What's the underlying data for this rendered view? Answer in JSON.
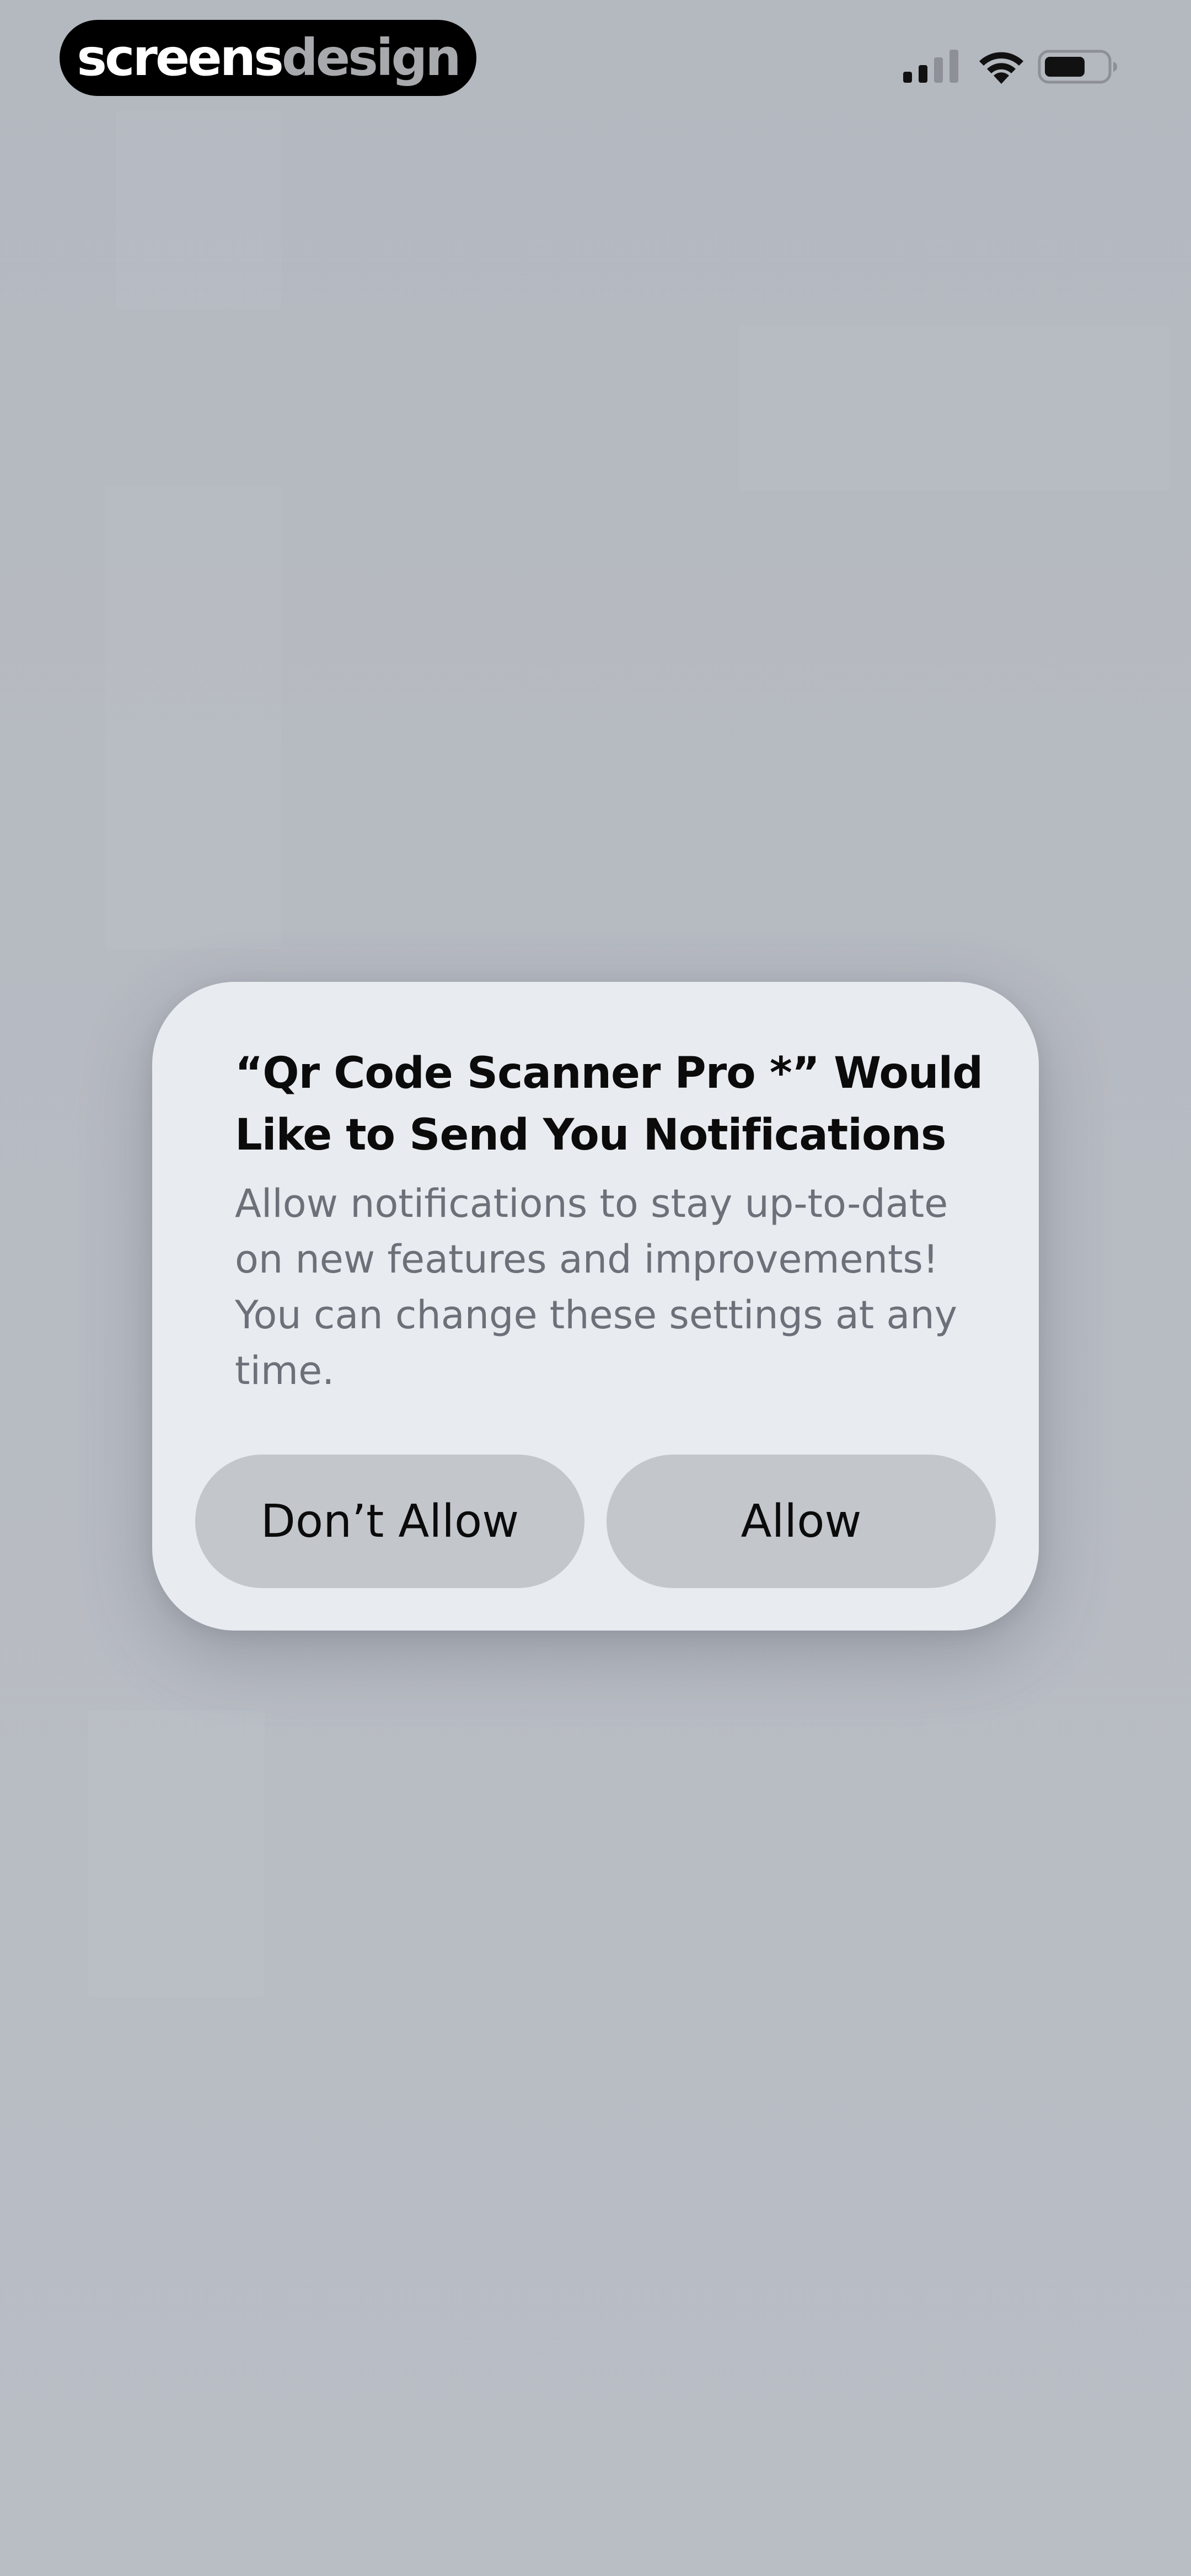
{
  "status_bar": {
    "brand": {
      "part1": "screens",
      "part2": "design"
    },
    "icons": [
      "signal-icon",
      "wifi-icon",
      "battery-icon"
    ]
  },
  "alert": {
    "title": "“Qr Code Scanner Pro *” Would Like to Send You Notifications",
    "message": "Allow notifications to stay up-to-date on new features and improvements! You can change these settings at any time.",
    "buttons": {
      "dont_allow": "Don’t Allow",
      "allow": "Allow"
    }
  },
  "colors": {
    "background_dim": "#b6bac1",
    "alert_background": "#e8ebef",
    "button_background": "#c3c7cc",
    "title_text": "#0b0b0c",
    "message_text": "#6c7079"
  }
}
